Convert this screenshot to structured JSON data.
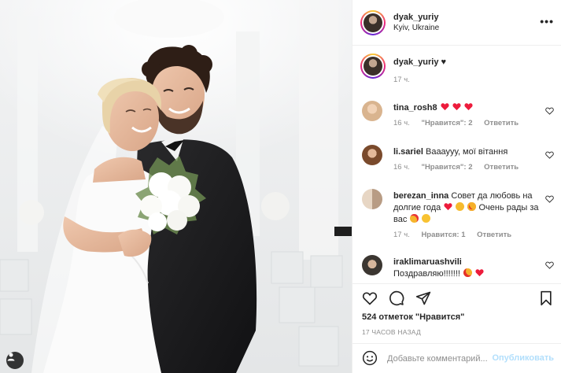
{
  "post": {
    "author": {
      "username": "dyak_yuriy",
      "location": "Kyiv, Ukraine",
      "avatar_icon": "profile-avatar-icon"
    },
    "more_icon": "more-options-icon",
    "more_label": "•••",
    "photo": {
      "icon": "wedding-photo",
      "tag_icon": "user-tag-icon"
    },
    "caption": {
      "username": "dyak_yuriy",
      "text": "♥",
      "time": "17 ч."
    },
    "comments": [
      {
        "username": "tina_rosh8",
        "text": "",
        "emoji": [
          "red-heart-emoji",
          "red-heart-emoji",
          "red-heart-emoji"
        ],
        "time": "16 ч.",
        "likes": "\"Нравится\": 2",
        "reply": "Ответить",
        "avatar_color": "#d9b48f"
      },
      {
        "username": "li.sariel",
        "text": "Ваааууу, мої вітання",
        "emoji": [],
        "time": "16 ч.",
        "likes": "\"Нравится\": 2",
        "reply": "Ответить",
        "avatar_color": "#7a4a2c"
      },
      {
        "username": "berezan_inna",
        "text_part1": "Совет да любовь на долгие года",
        "text_part2": "Очень рады за вас",
        "emoji_mid": [
          "red-heart-emoji",
          "clapping-hands-emoji",
          "heart-eyes-emoji"
        ],
        "emoji_end": [
          "smiling-hearts-emoji",
          "hugging-face-emoji"
        ],
        "time": "17 ч.",
        "likes": "Нравится: 1",
        "reply": "Ответить",
        "avatar_color": "#c9b8a6"
      },
      {
        "username": "iraklimaruashvili",
        "text": "Поздравляю!!!!!!!",
        "emoji": [
          "heart-eyes-emoji",
          "red-heart-emoji"
        ],
        "avatar_color": "#3b3631"
      }
    ],
    "actions": {
      "like_icon": "heart-icon",
      "comment_icon": "comment-icon",
      "share_icon": "share-icon",
      "save_icon": "bookmark-icon"
    },
    "likes_count": "524 отметок \"Нравится\"",
    "timestamp": "17 ЧАСОВ НАЗАД",
    "add_comment": {
      "emoji_icon": "smiley-icon",
      "placeholder": "Добавьте комментарий...",
      "publish_label": "Опубликовать"
    },
    "colors": {
      "text": "#262626",
      "muted": "#8e8e8e",
      "border": "#efefef",
      "publish_disabled": "#b2dffc",
      "heart_red": "#ed1c3c"
    }
  }
}
